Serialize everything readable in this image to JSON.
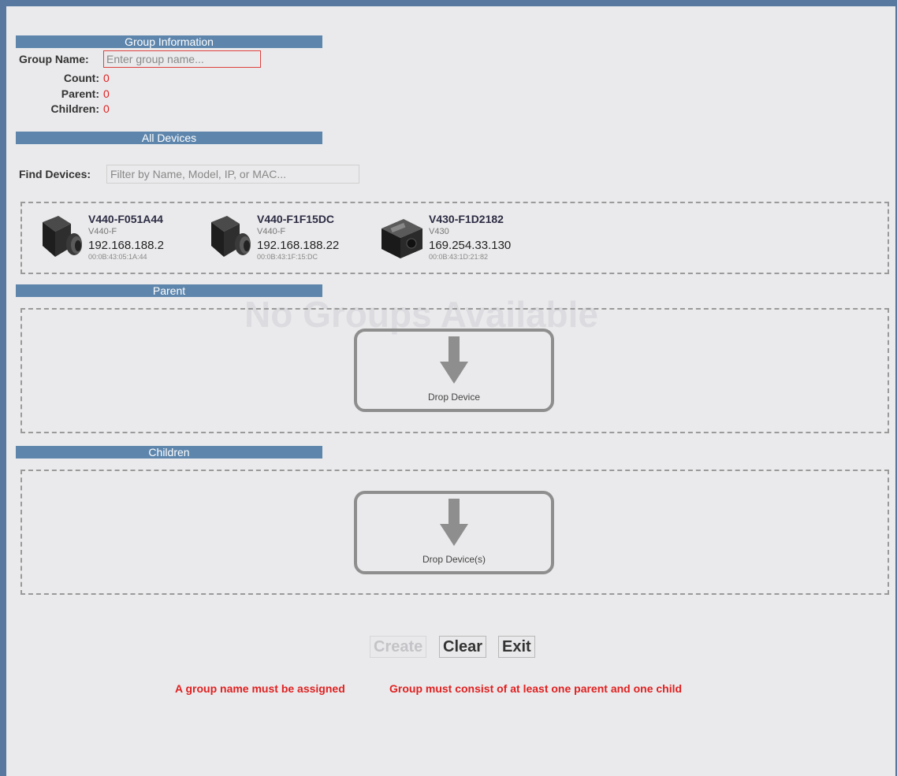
{
  "group_info": {
    "section_title": "Group Information",
    "name_label": "Group Name:",
    "name_placeholder": "Enter group name...",
    "name_value": "",
    "count_label": "Count:",
    "count_value": "0",
    "parent_label": "Parent:",
    "parent_value": "0",
    "children_label": "Children:",
    "children_value": "0"
  },
  "all_devices": {
    "section_title": "All Devices",
    "find_label": "Find Devices:",
    "find_placeholder": "Filter by Name, Model, IP, or MAC...",
    "devices": [
      {
        "name": "V440-F051A44",
        "model": "V440-F",
        "ip": "192.168.188.2",
        "mac": "00:0B:43:05:1A:44",
        "icon": "camera-v440-icon"
      },
      {
        "name": "V440-F1F15DC",
        "model": "V440-F",
        "ip": "192.168.188.22",
        "mac": "00:0B:43:1F:15:DC",
        "icon": "camera-v440-icon"
      },
      {
        "name": "V430-F1D2182",
        "model": "V430",
        "ip": "169.254.33.130",
        "mac": "00:0B:43:1D:21:82",
        "icon": "camera-v430-icon"
      }
    ]
  },
  "parent": {
    "section_title": "Parent",
    "drop_label": "Drop Device"
  },
  "children": {
    "section_title": "Children",
    "drop_label": "Drop Device(s)"
  },
  "background_ghost": {
    "text": "No Groups Available"
  },
  "buttons": {
    "create": "Create",
    "clear": "Clear",
    "exit": "Exit"
  },
  "errors": {
    "name_required": "A group name must be assigned",
    "members_required": "Group must consist of at least one parent and one child"
  },
  "colors": {
    "section_bar": "#5e86ad",
    "frame": "#5878a0",
    "error": "#e02020"
  }
}
